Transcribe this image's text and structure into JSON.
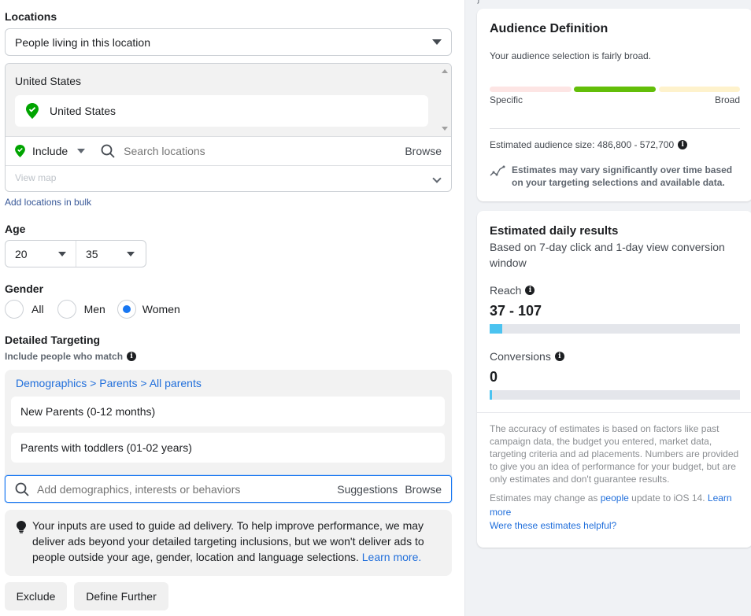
{
  "locations": {
    "label": "Locations",
    "type_select": "People living in this location",
    "group_title": "United States",
    "selected": [
      {
        "name": "United States",
        "mode": "include"
      }
    ],
    "include_select": "Include",
    "search_placeholder": "Search locations",
    "browse_label": "Browse",
    "view_map_label": "View map",
    "bulk_link": "Add locations in bulk"
  },
  "age": {
    "label": "Age",
    "min": "20",
    "max": "35"
  },
  "gender": {
    "label": "Gender",
    "options": [
      {
        "label": "All",
        "selected": false
      },
      {
        "label": "Men",
        "selected": false
      },
      {
        "label": "Women",
        "selected": true
      }
    ]
  },
  "detailed_targeting": {
    "label": "Detailed Targeting",
    "sublabel": "Include people who match",
    "breadcrumb": {
      "part1": "Demographics",
      "sep": ">",
      "part2": "Parents",
      "part3": "All parents"
    },
    "items": [
      "New Parents (0-12 months)",
      "Parents with toddlers (01-02 years)"
    ],
    "search_placeholder": "Add demographics, interests or behaviors",
    "suggestions_label": "Suggestions",
    "browse_label": "Browse",
    "notice_text": "Your inputs are used to guide ad delivery. To help improve performance, we may deliver ads beyond your detailed targeting inclusions, but we won't deliver ads to people outside your age, gender, location and language selections.",
    "notice_link": "Learn more.",
    "exclude_label": "Exclude",
    "define_further_label": "Define Further"
  },
  "audience_definition": {
    "brace_char": "}",
    "title": "Audience Definition",
    "summary": "Your audience selection is fairly broad.",
    "meter_active_segment": 2,
    "meter_segments": 3,
    "meter_left": "Specific",
    "meter_right": "Broad",
    "size_text": "Estimated audience size: 486,800 - 572,700",
    "variance_note": "Estimates may vary significantly over time based on your targeting selections and available data."
  },
  "daily_results": {
    "title": "Estimated daily results",
    "subtitle": "Based on 7-day click and 1-day view conversion window",
    "reach_label": "Reach",
    "reach_value": "37 - 107",
    "reach_fill_pct": 5,
    "conversions_label": "Conversions",
    "conversions_value": "0",
    "conversions_fill_pct": 1,
    "disclaimer": "The accuracy of estimates is based on factors like past campaign data, the budget you entered, market data, targeting criteria and ad placements. Numbers are provided to give you an idea of performance for your budget, but are only estimates and don't guarantee results.",
    "ios_prefix": "Estimates may change as",
    "ios_link": "people",
    "ios_suffix": "update to iOS 14.",
    "ios_learn_more": "Learn more",
    "helpful_link": "Were these estimates helpful?"
  },
  "colors": {
    "accent": "#1877f2",
    "link": "#216fdb",
    "meter_specific": "#fde5e4",
    "meter_active": "#63be09",
    "meter_broad": "#fef2cc",
    "bar_fill": "#4bc3f0",
    "include_green": "#00a400"
  }
}
